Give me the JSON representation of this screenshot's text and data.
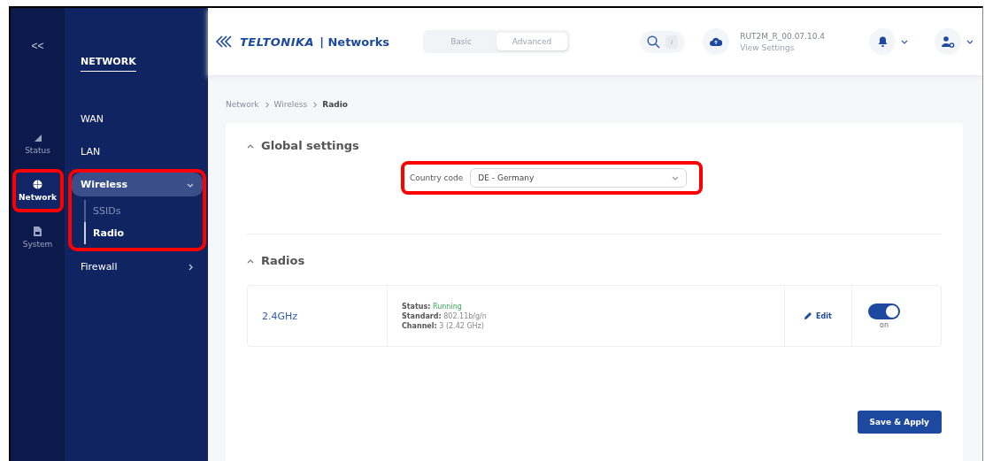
{
  "rail": {
    "collapse": "<<",
    "items": [
      {
        "label": "Status",
        "selected": false,
        "highlighted": false
      },
      {
        "label": "Network",
        "selected": true,
        "highlighted": true
      },
      {
        "label": "System",
        "selected": false,
        "highlighted": false
      }
    ]
  },
  "menu": {
    "title": "NETWORK",
    "items": [
      {
        "label": "WAN",
        "kind": "link",
        "selected": false,
        "highlighted": false
      },
      {
        "label": "LAN",
        "kind": "link",
        "selected": false,
        "highlighted": false
      },
      {
        "label": "Wireless",
        "kind": "group",
        "selected": true,
        "expanded": true,
        "highlighted": true,
        "children": [
          {
            "label": "SSIDs",
            "selected": false
          },
          {
            "label": "Radio",
            "selected": true
          }
        ]
      },
      {
        "label": "Firewall",
        "kind": "group",
        "selected": false,
        "expanded": false,
        "highlighted": false
      }
    ]
  },
  "header": {
    "logo": "TELTONIKA",
    "logo_suffix": "| Networks",
    "modes": [
      {
        "label": "Basic",
        "selected": false
      },
      {
        "label": "Advanced",
        "selected": true
      }
    ],
    "search_key": "/",
    "firmware": "RUT2M_R_00.07.10.4",
    "firmware_link": "View Settings"
  },
  "breadcrumb": [
    "Network",
    "Wireless",
    "Radio"
  ],
  "global_settings": {
    "title": "Global settings",
    "expanded": true,
    "field": {
      "label": "Country code",
      "value": "DE - Germany",
      "highlighted": true
    }
  },
  "radios": {
    "title": "Radios",
    "expanded": true,
    "rows": [
      {
        "name": "2.4GHz",
        "details": [
          {
            "label": "Status:",
            "value": "Running",
            "kind": "status"
          },
          {
            "label": "Standard:",
            "value": "802.11b/g/n",
            "kind": "plain"
          },
          {
            "label": "Channel:",
            "value": "3 (2.42 GHz)",
            "kind": "plain"
          }
        ],
        "edit": "Edit",
        "on": true,
        "toggle_label": "on"
      }
    ]
  },
  "save_button": "Save & Apply"
}
